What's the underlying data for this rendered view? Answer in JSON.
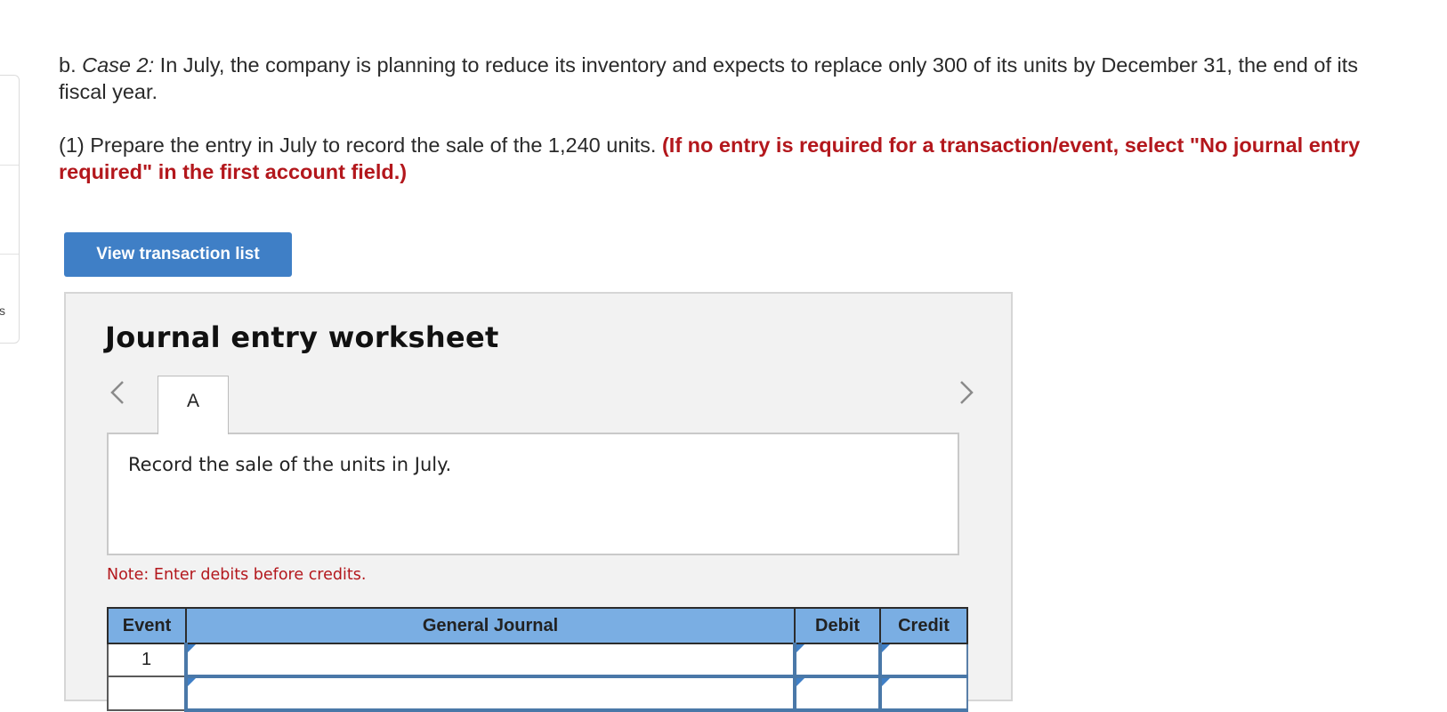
{
  "question": {
    "prefix": "b. ",
    "case_label": "Case 2:",
    "text": " In July, the company is planning to reduce its inventory and expects to replace only 300 of its units by December 31, the end of its fiscal year."
  },
  "instruction": {
    "text": "(1) Prepare the entry in July to record the sale of the 1,240 units. ",
    "red_text": "(If no entry is required for a transaction/event, select \"No journal entry required\" in the first account field.)"
  },
  "view_button_label": "View transaction list",
  "worksheet": {
    "title": "Journal entry worksheet",
    "tab_label": "A",
    "description": "Record the sale of the units in July.",
    "note": "Note: Enter debits before credits.",
    "columns": [
      "Event",
      "General Journal",
      "Debit",
      "Credit"
    ],
    "rows": [
      {
        "event": "1",
        "account": "",
        "debit": "",
        "credit": ""
      },
      {
        "event": "",
        "account": "",
        "debit": "",
        "credit": ""
      }
    ]
  },
  "side_glyph": "s"
}
